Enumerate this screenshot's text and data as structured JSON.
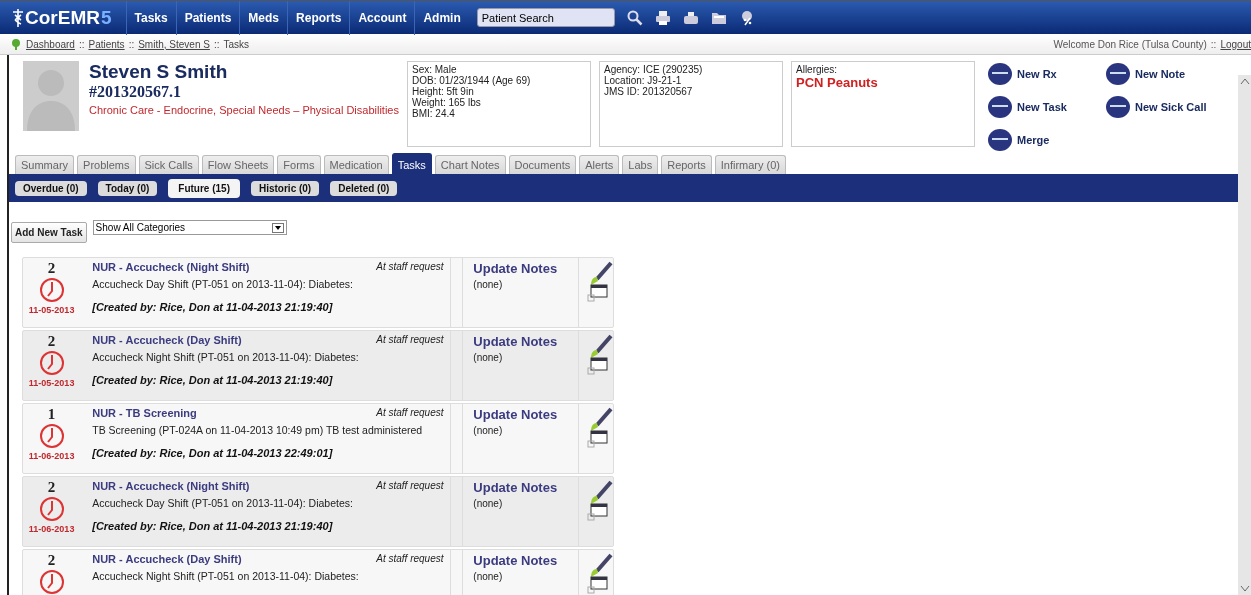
{
  "topbar": {
    "logo": "CorEMR",
    "logo_version": "5",
    "menu": [
      "Tasks",
      "Patients",
      "Meds",
      "Reports",
      "Account",
      "Admin"
    ],
    "search": {
      "placeholder": "Patient Search"
    }
  },
  "breadcrumb": [
    {
      "kind": "link",
      "label": "Dashboard"
    },
    {
      "kind": "sep",
      "label": "::"
    },
    {
      "kind": "link",
      "label": "Patients"
    },
    {
      "kind": "sep",
      "label": "::"
    },
    {
      "kind": "link",
      "label": "Smith, Steven S"
    },
    {
      "kind": "sep",
      "label": "::"
    },
    {
      "kind": "text",
      "label": "Tasks"
    }
  ],
  "welcome": {
    "text": "Welcome Don Rice (Tulsa County)",
    "sep": "::",
    "logout": "Logout"
  },
  "patient": {
    "name": "Steven S Smith",
    "number": "#201320567.1",
    "programs": "Chronic Care - Endocrine, Special Needs – Physical Disabilities"
  },
  "info_boxes": [
    {
      "lines": [
        "Sex: Male",
        "DOB: 01/23/1944 (Age 69)",
        "Height: 5ft 9in",
        "Weight: 165 lbs",
        "BMI: 24.4"
      ]
    },
    {
      "lines": [
        "Agency: ICE (290235)",
        "Location: J9-21-1",
        "JMS ID: 201320567"
      ]
    },
    {
      "lines": [
        "Allergies:"
      ],
      "alert": "PCN Peanuts"
    }
  ],
  "actions": [
    "New Rx",
    "New Note",
    "New Task",
    "New Sick Call",
    "Merge"
  ],
  "tabs": [
    {
      "label": "Summary",
      "selected": false
    },
    {
      "label": "Problems",
      "selected": false
    },
    {
      "label": "Sick Calls",
      "selected": false
    },
    {
      "label": "Flow Sheets",
      "selected": false
    },
    {
      "label": "Forms",
      "selected": false
    },
    {
      "label": "Medication",
      "selected": false
    },
    {
      "label": "Tasks",
      "selected": true
    },
    {
      "label": "Chart Notes",
      "selected": false
    },
    {
      "label": "Documents",
      "selected": false
    },
    {
      "label": "Alerts",
      "selected": false
    },
    {
      "label": "Labs",
      "selected": false
    },
    {
      "label": "Reports",
      "selected": false
    },
    {
      "label": "Infirmary (0)",
      "selected": false
    }
  ],
  "subtabs": [
    {
      "label": "Overdue (0)",
      "selected": false
    },
    {
      "label": "Today (0)",
      "selected": false
    },
    {
      "label": "Future (15)",
      "selected": true
    },
    {
      "label": "Historic (0)",
      "selected": false
    },
    {
      "label": "Deleted (0)",
      "selected": false
    }
  ],
  "add_button": "Add New Task",
  "category_select": {
    "value": "Show All Categories"
  },
  "tasks": [
    {
      "count": "2",
      "date": "11-05-2013",
      "title": "NUR - Accucheck (Night Shift)",
      "reason": "At staff request",
      "description": "Accucheck Day Shift (PT-051 on 2013-11-04): Diabetes:",
      "created": "[Created by: Rice, Don at 11-04-2013 21:19:40]",
      "notes_link": "Update Notes",
      "notes": "(none)"
    },
    {
      "count": "2",
      "date": "11-05-2013",
      "title": "NUR - Accucheck (Day Shift)",
      "reason": "At staff request",
      "description": "Accucheck Night Shift (PT-051 on 2013-11-04): Diabetes:",
      "created": "[Created by: Rice, Don at 11-04-2013 21:19:40]",
      "notes_link": "Update Notes",
      "notes": "(none)"
    },
    {
      "count": "1",
      "date": "11-06-2013",
      "title": "NUR - TB Screening",
      "reason": "At staff request",
      "description": "TB Screening (PT-024A on 11-04-2013 10:49 pm) TB test administered",
      "created": "[Created by: Rice, Don at 11-04-2013 22:49:01]",
      "notes_link": "Update Notes",
      "notes": "(none)"
    },
    {
      "count": "2",
      "date": "11-06-2013",
      "title": "NUR - Accucheck (Night Shift)",
      "reason": "At staff request",
      "description": "Accucheck Day Shift (PT-051 on 2013-11-04): Diabetes:",
      "created": "[Created by: Rice, Don at 11-04-2013 21:19:40]",
      "notes_link": "Update Notes",
      "notes": "(none)"
    },
    {
      "count": "2",
      "title": "NUR - Accucheck (Day Shift)",
      "reason": "At staff request",
      "description": "Accucheck Night Shift (PT-051 on 2013-11-04): Diabetes:",
      "notes_link": "Update Notes",
      "notes": "(none)"
    }
  ]
}
